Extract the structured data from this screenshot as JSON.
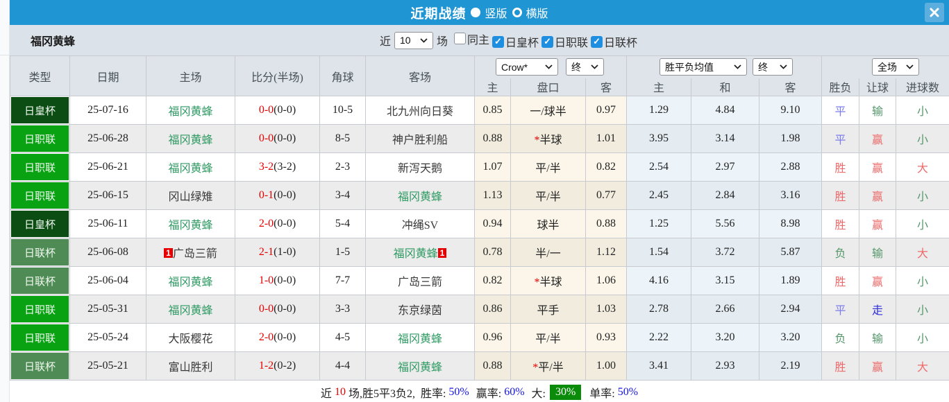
{
  "titlebar": {
    "title": "近期战绩",
    "radios": [
      {
        "label": "竖版",
        "selected": true
      },
      {
        "label": "横版",
        "selected": false
      }
    ]
  },
  "filterbar": {
    "team": "福冈黄蜂",
    "recent_label": "近",
    "recent_value": "10",
    "unit_label": "场",
    "checkboxes": [
      {
        "label": "同主",
        "checked": false
      },
      {
        "label": "日皇杯",
        "checked": true
      },
      {
        "label": "日职联",
        "checked": true
      },
      {
        "label": "日联杯",
        "checked": true
      }
    ]
  },
  "table": {
    "headers": {
      "type": "类型",
      "date": "日期",
      "home": "主场",
      "score": "比分(半场)",
      "corner": "角球",
      "away": "客场",
      "sub": [
        "主",
        "盘口",
        "客",
        "主",
        "和",
        "客",
        "胜负",
        "让球",
        "进球数"
      ]
    },
    "selects": {
      "bookmaker": "Crow*",
      "asian_time": "终",
      "avg": "胜平负均值",
      "euro_time": "终",
      "scope": "全场"
    },
    "self_team": "福冈黄蜂",
    "rows": [
      {
        "type": "日皇杯",
        "date": "25-07-16",
        "home": "福冈黄蜂",
        "home_badge": "",
        "score_ft": "0-0",
        "score_ht": "(0-0)",
        "corner": "10-5",
        "away": "北九州向日葵",
        "away_badge": "",
        "odds_home": "0.85",
        "handicap": "一/球半",
        "handicap_star": false,
        "odds_away": "0.97",
        "euro_home": "1.29",
        "euro_draw": "4.84",
        "euro_away": "9.10",
        "wdl": "平",
        "handicap_result": "输",
        "ou": "小"
      },
      {
        "type": "日职联",
        "date": "25-06-28",
        "home": "福冈黄蜂",
        "home_badge": "",
        "score_ft": "0-0",
        "score_ht": "(0-0)",
        "corner": "8-5",
        "away": "神户胜利船",
        "away_badge": "",
        "odds_home": "0.88",
        "handicap": "半球",
        "handicap_star": true,
        "odds_away": "1.01",
        "euro_home": "3.95",
        "euro_draw": "3.14",
        "euro_away": "1.98",
        "wdl": "平",
        "handicap_result": "赢",
        "ou": "小"
      },
      {
        "type": "日职联",
        "date": "25-06-21",
        "home": "福冈黄蜂",
        "home_badge": "",
        "score_ft": "3-2",
        "score_ht": "(3-2)",
        "corner": "2-3",
        "away": "新泻天鹅",
        "away_badge": "",
        "odds_home": "1.07",
        "handicap": "平/半",
        "handicap_star": false,
        "odds_away": "0.82",
        "euro_home": "2.54",
        "euro_draw": "2.97",
        "euro_away": "2.88",
        "wdl": "胜",
        "handicap_result": "赢",
        "ou": "大"
      },
      {
        "type": "日职联",
        "date": "25-06-15",
        "home": "冈山绿雉",
        "home_badge": "",
        "score_ft": "0-1",
        "score_ht": "(0-0)",
        "corner": "3-4",
        "away": "福冈黄蜂",
        "away_badge": "",
        "odds_home": "1.13",
        "handicap": "平/半",
        "handicap_star": false,
        "odds_away": "0.77",
        "euro_home": "2.45",
        "euro_draw": "2.84",
        "euro_away": "3.16",
        "wdl": "胜",
        "handicap_result": "赢",
        "ou": "小"
      },
      {
        "type": "日皇杯",
        "date": "25-06-11",
        "home": "福冈黄蜂",
        "home_badge": "",
        "score_ft": "2-0",
        "score_ht": "(0-0)",
        "corner": "5-4",
        "away": "冲绳SV",
        "away_badge": "",
        "odds_home": "0.94",
        "handicap": "球半",
        "handicap_star": false,
        "odds_away": "0.88",
        "euro_home": "1.25",
        "euro_draw": "5.56",
        "euro_away": "8.98",
        "wdl": "胜",
        "handicap_result": "赢",
        "ou": "小"
      },
      {
        "type": "日联杯",
        "date": "25-06-08",
        "home": "广岛三箭",
        "home_badge": "1",
        "score_ft": "2-1",
        "score_ht": "(1-0)",
        "corner": "1-5",
        "away": "福冈黄蜂",
        "away_badge": "1",
        "odds_home": "0.78",
        "handicap": "半/一",
        "handicap_star": false,
        "odds_away": "1.12",
        "euro_home": "1.54",
        "euro_draw": "3.72",
        "euro_away": "5.87",
        "wdl": "负",
        "handicap_result": "输",
        "ou": "大"
      },
      {
        "type": "日联杯",
        "date": "25-06-04",
        "home": "福冈黄蜂",
        "home_badge": "",
        "score_ft": "1-0",
        "score_ht": "(0-0)",
        "corner": "7-7",
        "away": "广岛三箭",
        "away_badge": "",
        "odds_home": "0.82",
        "handicap": "半球",
        "handicap_star": true,
        "odds_away": "1.06",
        "euro_home": "4.16",
        "euro_draw": "3.15",
        "euro_away": "1.89",
        "wdl": "胜",
        "handicap_result": "赢",
        "ou": "小"
      },
      {
        "type": "日职联",
        "date": "25-05-31",
        "home": "福冈黄蜂",
        "home_badge": "",
        "score_ft": "0-0",
        "score_ht": "(0-0)",
        "corner": "3-3",
        "away": "东京绿茵",
        "away_badge": "",
        "odds_home": "0.86",
        "handicap": "平手",
        "handicap_star": false,
        "odds_away": "1.03",
        "euro_home": "2.78",
        "euro_draw": "2.66",
        "euro_away": "2.94",
        "wdl": "平",
        "handicap_result": "走",
        "ou": "小"
      },
      {
        "type": "日职联",
        "date": "25-05-24",
        "home": "大阪樱花",
        "home_badge": "",
        "score_ft": "2-0",
        "score_ht": "(0-0)",
        "corner": "4-5",
        "away": "福冈黄蜂",
        "away_badge": "",
        "odds_home": "0.96",
        "handicap": "平/半",
        "handicap_star": false,
        "odds_away": "0.93",
        "euro_home": "2.22",
        "euro_draw": "3.20",
        "euro_away": "3.20",
        "wdl": "负",
        "handicap_result": "输",
        "ou": "小"
      },
      {
        "type": "日联杯",
        "date": "25-05-21",
        "home": "富山胜利",
        "home_badge": "",
        "score_ft": "1-2",
        "score_ht": "(0-2)",
        "corner": "4-4",
        "away": "福冈黄蜂",
        "away_badge": "",
        "odds_home": "0.88",
        "handicap": "平/半",
        "handicap_star": true,
        "odds_away": "1.00",
        "euro_home": "3.41",
        "euro_draw": "2.93",
        "euro_away": "2.19",
        "wdl": "胜",
        "handicap_result": "赢",
        "ou": "大"
      }
    ]
  },
  "footer": {
    "prefix": "近",
    "count": "10",
    "summary": "场,胜5平3负2,",
    "win_rate_label": "胜率:",
    "win_rate": "50%",
    "handicap_rate_label": "赢率:",
    "handicap_rate": "60%",
    "big_label": "大:",
    "big_rate": "30%",
    "single_label": "单率:",
    "single_rate": "50%"
  },
  "colors": {
    "titlebar_blue": "#2095d3",
    "badge_emperor_green": "#0b4d12",
    "badge_j1_green": "#09a213",
    "badge_jcup_green": "#4f8c55",
    "team_highlight_green": "#2f9a63",
    "score_red": "#e60000",
    "result_red": "#ee6a6a",
    "result_green": "#55976b",
    "result_blue": "#7b7bea",
    "result_blue_strong": "#2d2de0",
    "footer_value_blue": "#1414e6",
    "footer_big_badge_green": "#0a8c0a"
  }
}
